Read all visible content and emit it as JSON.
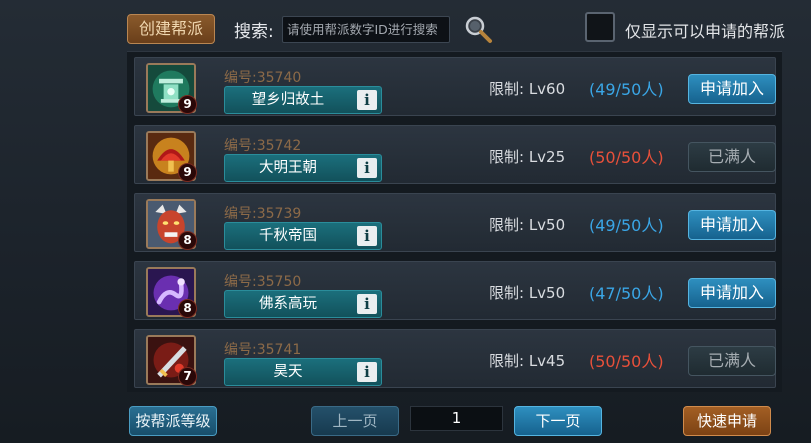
{
  "toolbar": {
    "create_label": "创建帮派",
    "search_label": "搜索:",
    "search_placeholder": "请使用帮派数字ID进行搜索",
    "filter_label": "仅显示可以申请的帮派"
  },
  "guilds": [
    {
      "level_badge": "9",
      "id_text": "编号:35740",
      "name": "望乡归故土",
      "limit": "限制: Lv60",
      "members": "(49/50人)",
      "full": false,
      "action": "申请加入",
      "avatar_icon": "jade-lantern-icon"
    },
    {
      "level_badge": "9",
      "id_text": "编号:35742",
      "name": "大明王朝",
      "limit": "限制: Lv25",
      "members": "(50/50人)",
      "full": true,
      "action": "已满人",
      "avatar_icon": "red-fan-icon"
    },
    {
      "level_badge": "8",
      "id_text": "编号:35739",
      "name": "千秋帝国",
      "limit": "限制: Lv50",
      "members": "(49/50人)",
      "full": false,
      "action": "申请加入",
      "avatar_icon": "demon-mask-icon"
    },
    {
      "level_badge": "8",
      "id_text": "编号:35750",
      "name": "佛系高玩",
      "limit": "限制: Lv50",
      "members": "(47/50人)",
      "full": false,
      "action": "申请加入",
      "avatar_icon": "purple-serpent-icon"
    },
    {
      "level_badge": "7",
      "id_text": "编号:35741",
      "name": "昊天",
      "limit": "限制: Lv45",
      "members": "(50/50人)",
      "full": true,
      "action": "已满人",
      "avatar_icon": "crimson-blade-icon"
    }
  ],
  "footer": {
    "sort_label": "按帮派等级",
    "prev_label": "上一页",
    "page_value": "1",
    "next_label": "下一页",
    "quick_label": "快速申请"
  },
  "colors": {
    "members_available": "#3aa6e6",
    "members_full": "#e8503a",
    "accent_button": "#16628e",
    "create_button": "#6a3f1a"
  }
}
